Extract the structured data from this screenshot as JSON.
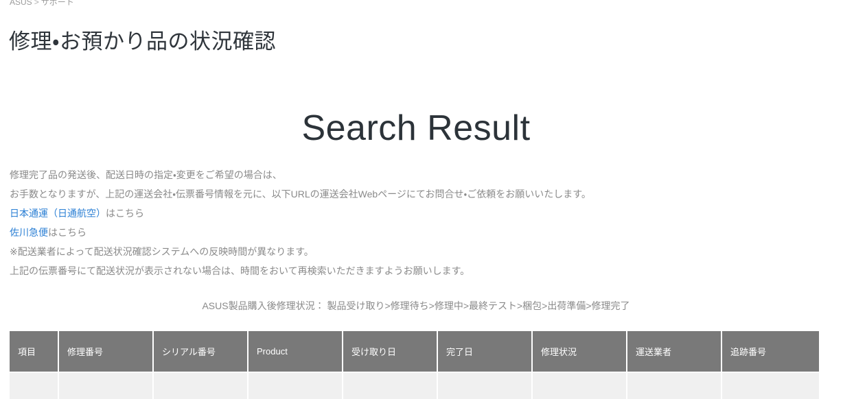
{
  "breadcrumb": {
    "root": "ASUS",
    "separator": ">",
    "current": "サポート"
  },
  "header": {
    "page_title": "修理・お預かり品の状況確認"
  },
  "main": {
    "result_heading": "Search Result",
    "notice": {
      "line1": "修理完了品の発送後、配送日時の指定・変更をご希望の場合は、",
      "line2": "お手数となりますが、上記の運送会社・伝票番号情報を元に、以下URLの運送会社Webページにてお問合せ・ご依頼をお願いいたします。",
      "link1_label": "日本通運（日通航空）",
      "link1_suffix": "はこちら",
      "link2_label": "佐川急便",
      "link2_suffix": "はこちら",
      "line3": "※配送業者によって配送状況確認システムへの反映時間が異なります。",
      "line4": "上記の伝票番号にて配送状況が表示されない場合は、時間をおいて再検索いただきますようお願いします。"
    },
    "status_flow": "ASUS製品購入後修理状況： 製品受け取り>修理待ち>修理中>最終テスト>梱包>出荷準備>修理完了",
    "table": {
      "columns": [
        "項目",
        "修理番号",
        "シリアル番号",
        "Product",
        "受け取り日",
        "完了日",
        "修理状況",
        "運送業者",
        "追跡番号"
      ],
      "rows": [
        [
          "",
          "",
          "",
          "",
          "",
          "",
          "",
          "",
          ""
        ]
      ]
    }
  },
  "colors": {
    "link": "#2b7fd4",
    "table_header_bg": "#797979",
    "table_row_bg": "#f0f0f0",
    "body_text": "#8a8a8a",
    "title_text": "#2f353b"
  }
}
